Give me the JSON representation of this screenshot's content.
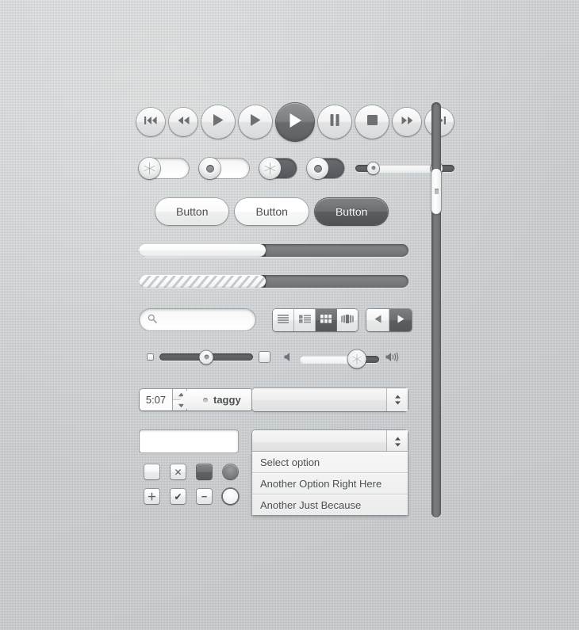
{
  "transport": {
    "buttons": [
      {
        "name": "rewind-to-start-button",
        "icon": "skip-backward-icon",
        "size": "small",
        "style": "light"
      },
      {
        "name": "rewind-button",
        "icon": "rewind-icon",
        "size": "small",
        "style": "light"
      },
      {
        "name": "play-button-1",
        "icon": "play-icon",
        "size": "normal",
        "style": "light"
      },
      {
        "name": "play-button-2",
        "icon": "play-icon",
        "size": "normal",
        "style": "light"
      },
      {
        "name": "play-button-active",
        "icon": "play-icon",
        "size": "large",
        "style": "dark"
      },
      {
        "name": "pause-button",
        "icon": "pause-icon",
        "size": "normal",
        "style": "light"
      },
      {
        "name": "stop-button",
        "icon": "stop-icon",
        "size": "normal",
        "style": "light"
      },
      {
        "name": "fast-forward-button",
        "icon": "fast-forward-icon",
        "size": "small",
        "style": "light"
      },
      {
        "name": "skip-to-end-button",
        "icon": "skip-forward-icon",
        "size": "small",
        "style": "light"
      }
    ]
  },
  "toggles": [
    {
      "name": "toggle-switch-on-spoked",
      "state": "on",
      "knob": "spoked",
      "width": "wide"
    },
    {
      "name": "toggle-switch-on-dotted",
      "state": "on",
      "knob": "dotted",
      "width": "wide"
    },
    {
      "name": "toggle-switch-off-spoked",
      "state": "off",
      "knob": "spoked",
      "width": "narrow"
    },
    {
      "name": "toggle-switch-off-dotted",
      "state": "off",
      "knob": "dotted",
      "width": "narrow"
    }
  ],
  "range_slider": {
    "name": "range-slider",
    "low_percent": 18,
    "high_percent": 82
  },
  "buttons": [
    {
      "label": "Button",
      "style": "light"
    },
    {
      "label": "Button",
      "style": "bright"
    },
    {
      "label": "Button",
      "style": "dark"
    }
  ],
  "progress_bars": [
    {
      "name": "progress-bar-plain",
      "value_percent": 47,
      "style": "plain"
    },
    {
      "name": "progress-bar-striped",
      "value_percent": 47,
      "style": "striped"
    }
  ],
  "search": {
    "placeholder": "",
    "icon": "search-icon"
  },
  "view_segmented": {
    "segments": [
      {
        "icon": "list-view-icon",
        "selected": false
      },
      {
        "icon": "list-detail-view-icon",
        "selected": false
      },
      {
        "icon": "grid-view-icon",
        "selected": true
      },
      {
        "icon": "coverflow-view-icon",
        "selected": false
      }
    ]
  },
  "nav_arrows": {
    "segments": [
      {
        "icon": "arrow-left-icon",
        "selected": false
      },
      {
        "icon": "arrow-right-icon",
        "selected": true
      }
    ]
  },
  "slider_size": {
    "name": "size-slider",
    "value_percent": 50,
    "left_icon": "small-square-icon",
    "right_icon": "large-square-icon"
  },
  "slider_volume": {
    "name": "volume-slider",
    "value_percent": 72,
    "left_icon": "speaker-mute-icon",
    "right_icon": "speaker-loud-icon"
  },
  "stepper": {
    "value": "5:07",
    "up_icon": "caret-up-icon",
    "down_icon": "caret-down-icon"
  },
  "tag": {
    "label": "taggy",
    "icon": "tag-hole-icon"
  },
  "select_top": {
    "value": "",
    "arrow_icon": "updown-arrows-icon"
  },
  "text_input": {
    "value": "",
    "placeholder": ""
  },
  "select_open": {
    "value": "",
    "arrow_icon": "updown-arrows-icon"
  },
  "dropdown_options": [
    "Select option",
    "Another Option Right Here",
    "Another Just Because"
  ],
  "checkboxes_row1": [
    {
      "name": "checkbox-empty",
      "glyph": "",
      "state": "unchecked"
    },
    {
      "name": "checkbox-cross",
      "glyph": "✕",
      "state": "cross"
    },
    {
      "name": "checkbox-filled",
      "glyph": "",
      "state": "filled"
    },
    {
      "name": "radio-selected-dark",
      "glyph": "",
      "state": "dark"
    }
  ],
  "checkboxes_row2": [
    {
      "name": "checkbox-plus",
      "glyph": "＋",
      "state": "plus"
    },
    {
      "name": "checkbox-check",
      "glyph": "✔",
      "state": "checked"
    },
    {
      "name": "checkbox-minus",
      "glyph": "−",
      "state": "minus"
    },
    {
      "name": "radio-unselected-light",
      "glyph": "",
      "state": "light"
    }
  ],
  "scrollbar": {
    "name": "vertical-scrollbar",
    "thumb_top_percent": 16,
    "thumb_height_percent": 11
  },
  "colors": {
    "background": "#cfd3d5",
    "dark_control": "#6b6e71",
    "text": "#4a4d50",
    "track_dark": "#55585b"
  }
}
